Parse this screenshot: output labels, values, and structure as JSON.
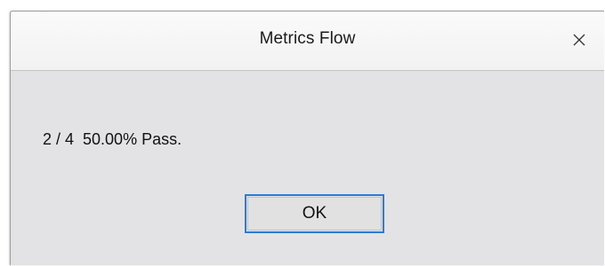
{
  "window": {
    "title": "Metrics Flow",
    "close_icon": "close-icon"
  },
  "message": {
    "text": "2 / 4  50.00% Pass."
  },
  "buttons": {
    "ok_label": "OK"
  },
  "colors": {
    "dialog_bg": "#e3e3e6",
    "titlebar_bg": "#f5f5f5",
    "focus_border": "#2f7bd3"
  }
}
